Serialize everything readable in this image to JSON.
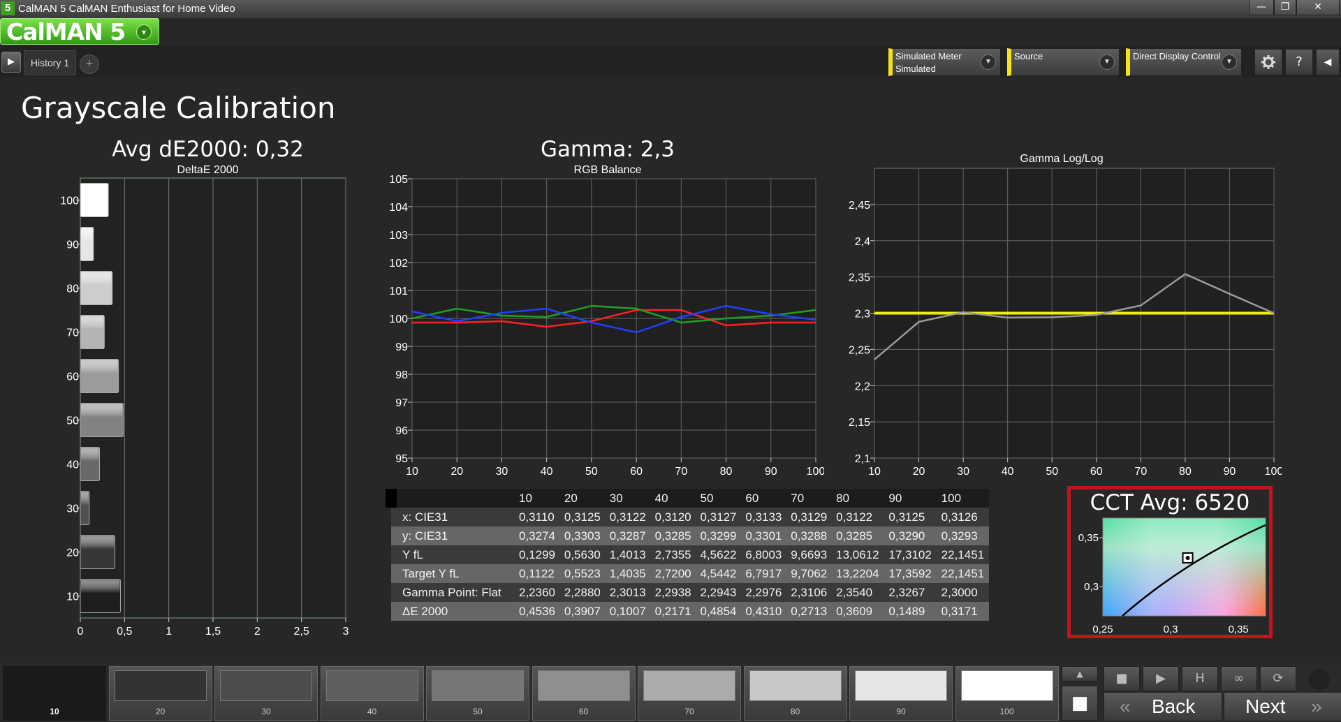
{
  "window": {
    "app_badge": "5",
    "title": "CalMAN 5 CalMAN Enthusiast for Home Video",
    "minimize": "—",
    "restore": "❐",
    "close": "✕"
  },
  "logo": {
    "text": "CalMAN 5",
    "arrow": "▾"
  },
  "tabs": {
    "play": "▶",
    "history": "History 1",
    "add": "+"
  },
  "devices": [
    {
      "label": "Simulated Meter",
      "value": "Simulated"
    },
    {
      "label": "Source",
      "value": ""
    },
    {
      "label": "Direct Display Control",
      "value": ""
    }
  ],
  "toolbar": {
    "settings_icon": "gear-icon",
    "help": "?",
    "collapse": "◀"
  },
  "page": {
    "title": "Grayscale Calibration"
  },
  "charts": {
    "de_title": "Avg dE2000: 0,32",
    "de_subtitle": "DeltaE 2000",
    "gamma_title": "Gamma: 2,3",
    "rgb_subtitle": "RGB Balance",
    "loglog_subtitle": "Gamma Log/Log",
    "cct_title": "CCT Avg: 6520"
  },
  "chart_data": [
    {
      "type": "bar",
      "title": "Avg dE2000: 0,32",
      "subtitle": "DeltaE 2000",
      "orientation": "horizontal",
      "categories": [
        "10",
        "20",
        "30",
        "40",
        "50",
        "60",
        "70",
        "80",
        "90",
        "100"
      ],
      "values": [
        0.4536,
        0.3907,
        0.1007,
        0.2171,
        0.4854,
        0.431,
        0.2713,
        0.3609,
        0.1489,
        0.3171
      ],
      "xlim": [
        0,
        3
      ],
      "xticks": [
        "0",
        "0,5",
        "1",
        "1,5",
        "2",
        "2,5",
        "3"
      ]
    },
    {
      "type": "line",
      "title": "Gamma: 2,3",
      "subtitle": "RGB Balance",
      "x": [
        10,
        20,
        30,
        40,
        50,
        60,
        70,
        80,
        90,
        100
      ],
      "ylim": [
        95,
        105
      ],
      "yticks": [
        "95",
        "96",
        "97",
        "98",
        "99",
        "100",
        "101",
        "102",
        "103",
        "104",
        "105"
      ],
      "series": [
        {
          "color": "#ff2020",
          "values": [
            99.85,
            99.85,
            99.9,
            99.7,
            99.9,
            100.3,
            100.3,
            99.75,
            99.85,
            99.85
          ]
        },
        {
          "color": "#20a020",
          "values": [
            100.0,
            100.35,
            100.1,
            100.05,
            100.45,
            100.35,
            99.85,
            100.0,
            100.1,
            100.3
          ]
        },
        {
          "color": "#2040ff",
          "values": [
            100.25,
            99.9,
            100.2,
            100.35,
            99.85,
            99.5,
            100.05,
            100.45,
            100.15,
            99.95
          ]
        }
      ]
    },
    {
      "type": "line",
      "subtitle": "Gamma Log/Log",
      "x": [
        10,
        20,
        30,
        40,
        50,
        60,
        70,
        80,
        90,
        100
      ],
      "ylim": [
        2.1,
        2.5
      ],
      "yticks": [
        {
          "v": 2.1,
          "t": "2,1"
        },
        {
          "v": 2.15,
          "t": "2,15"
        },
        {
          "v": 2.2,
          "t": "2,2"
        },
        {
          "v": 2.25,
          "t": "2,25"
        },
        {
          "v": 2.3,
          "t": "2,3"
        },
        {
          "v": 2.35,
          "t": "2,35"
        },
        {
          "v": 2.4,
          "t": "2,4"
        },
        {
          "v": 2.45,
          "t": "2,45"
        }
      ],
      "series": [
        {
          "color": "#f0ec10",
          "values": [
            2.3,
            2.3,
            2.3,
            2.3,
            2.3,
            2.3,
            2.3,
            2.3,
            2.3,
            2.3
          ]
        },
        {
          "color": "#9a9a9a",
          "values": [
            2.236,
            2.288,
            2.3013,
            2.2938,
            2.2943,
            2.2976,
            2.3106,
            2.354,
            2.3267,
            2.3
          ]
        }
      ]
    },
    {
      "type": "scatter",
      "title": "CCT Avg: 6520",
      "xlim": [
        0.25,
        0.37
      ],
      "ylim": [
        0.27,
        0.37
      ],
      "xticks": [
        "0,25",
        "0,3",
        "0,35"
      ],
      "yticks": [
        "0,3",
        "0,35"
      ],
      "points": [
        {
          "x": 0.3126,
          "y": 0.3293
        }
      ]
    }
  ],
  "table": {
    "headers": [
      "",
      "10",
      "20",
      "30",
      "40",
      "50",
      "60",
      "70",
      "80",
      "90",
      "100"
    ],
    "rows": [
      {
        "label": "x: CIE31",
        "values": [
          "0,3110",
          "0,3125",
          "0,3122",
          "0,3120",
          "0,3127",
          "0,3133",
          "0,3129",
          "0,3122",
          "0,3125",
          "0,3126"
        ]
      },
      {
        "label": "y: CIE31",
        "values": [
          "0,3274",
          "0,3303",
          "0,3287",
          "0,3285",
          "0,3299",
          "0,3301",
          "0,3288",
          "0,3285",
          "0,3290",
          "0,3293"
        ]
      },
      {
        "label": "Y fL",
        "values": [
          "0,1299",
          "0,5630",
          "1,4013",
          "2,7355",
          "4,5622",
          "6,8003",
          "9,6693",
          "13,0612",
          "17,3102",
          "22,1451"
        ]
      },
      {
        "label": "Target Y fL",
        "values": [
          "0,1122",
          "0,5523",
          "1,4035",
          "2,7200",
          "4,5442",
          "6,7917",
          "9,7062",
          "13,2204",
          "17,3592",
          "22,1451"
        ]
      },
      {
        "label": "Gamma Point: Flat",
        "values": [
          "2,2360",
          "2,2880",
          "2,3013",
          "2,2938",
          "2,2943",
          "2,2976",
          "2,3106",
          "2,3540",
          "2,3267",
          "2,3000"
        ]
      },
      {
        "label": "ΔE 2000",
        "values": [
          "0,4536",
          "0,3907",
          "0,1007",
          "0,2171",
          "0,4854",
          "0,4310",
          "0,2713",
          "0,3609",
          "0,1489",
          "0,3171"
        ]
      }
    ]
  },
  "swatches": [
    {
      "label": "10",
      "color": "#1a1a1a"
    },
    {
      "label": "20",
      "color": "#333333"
    },
    {
      "label": "30",
      "color": "#4d4d4d"
    },
    {
      "label": "40",
      "color": "#5e5e5e"
    },
    {
      "label": "50",
      "color": "#767676"
    },
    {
      "label": "60",
      "color": "#8f8f8f"
    },
    {
      "label": "70",
      "color": "#ababab"
    },
    {
      "label": "80",
      "color": "#c8c8c8"
    },
    {
      "label": "90",
      "color": "#e6e6e6"
    },
    {
      "label": "100",
      "color": "#ffffff"
    }
  ],
  "controls": {
    "up": "▲",
    "stop_big": "■",
    "stop": "■",
    "play": "▶",
    "hold": "H",
    "loop": "∞",
    "refresh": "⟳",
    "back": "Back",
    "next": "Next",
    "back_arrows": "«",
    "next_arrows": "»"
  },
  "colors": {
    "accent": "#f4e21b",
    "cct_border": "#c4141a",
    "logo_green": "#3c9f1f"
  }
}
